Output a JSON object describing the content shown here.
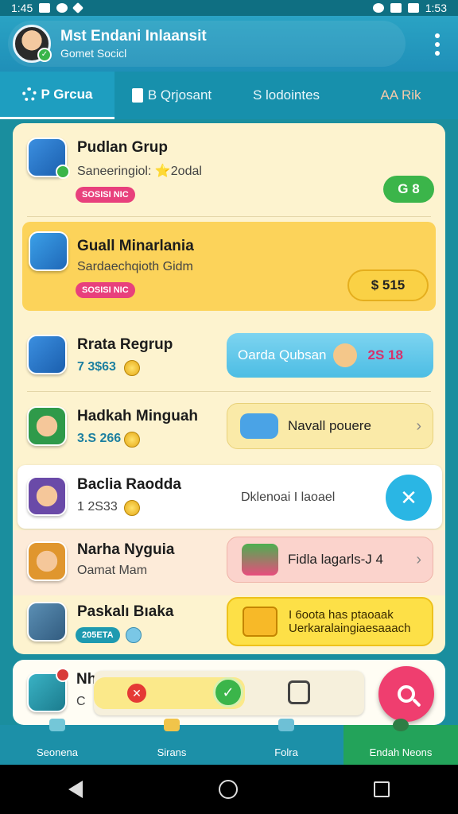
{
  "status_bar": {
    "time": "1:45",
    "battery_time": "1:53"
  },
  "header": {
    "title": "Mst Endani Inlaansit",
    "subtitle": "Gomet Socicl"
  },
  "tabs": [
    {
      "label": "P Grcua",
      "icon": "gear-icon",
      "active": true
    },
    {
      "label": "B Qrjosant",
      "icon": "document-icon",
      "active": false
    },
    {
      "label": "S lodointes",
      "icon": "",
      "active": false
    },
    {
      "label": "AA Rik",
      "icon": "",
      "active": false
    }
  ],
  "list": [
    {
      "title": "Pudlan Grup",
      "subtitle": "Saneeringiol: ⭐2odal",
      "tag": "SOSISI NIC",
      "action": "G 8"
    },
    {
      "title": "Guall Minarlania",
      "subtitle": "Sardaechqioth Gidm",
      "tag": "SOSISI NIC",
      "action": "$ 515"
    },
    {
      "title": "Rrata Regrup",
      "subtitle": "7 3$63",
      "chip_text": "Oarda Qubsan",
      "chip_value": "2S 18"
    },
    {
      "title": "Hadkah Minguah",
      "subtitle": "3.S 266",
      "chip_text": "Navall pouere"
    },
    {
      "title": "Baclia Raodda",
      "subtitle": "1 2S33",
      "chip_text": "Dklenoai I laoael"
    },
    {
      "title": "Narha Nyguia",
      "subtitle": "Oamat Mam",
      "chip_text": "Fidla lagarls-J 4"
    },
    {
      "title": "Paskalı Bıaka",
      "subtitle": "205ETA",
      "chip_text": "I 6oota has ptaoaak Uerkaralaingiaesaaach"
    }
  ],
  "bottom_card": {
    "title": "Nh",
    "subtitle": "C"
  },
  "nav": [
    {
      "label": "Seonena",
      "active": false
    },
    {
      "label": "Sirans",
      "active": false
    },
    {
      "label": "Folra",
      "active": false
    },
    {
      "label": "Endah Neons",
      "active": true
    }
  ],
  "colors": {
    "primary": "#1790ac",
    "accent_pink": "#ef3e6f",
    "accent_green": "#3bb54a",
    "highlight_row": "#fcd35a"
  }
}
